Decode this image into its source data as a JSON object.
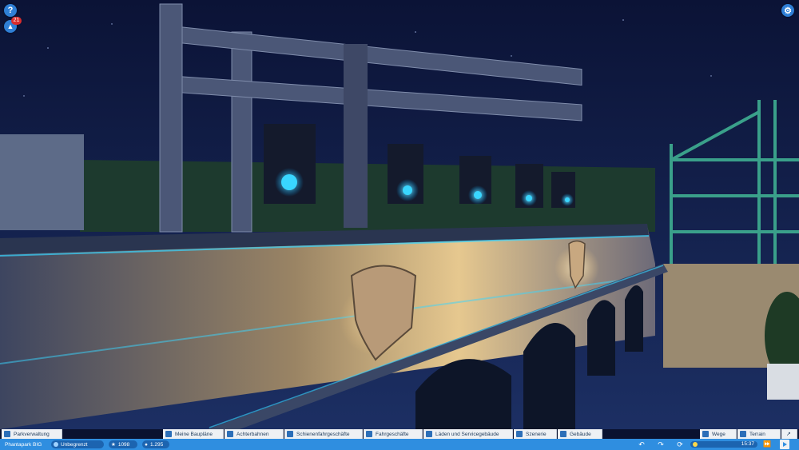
{
  "overlay": {
    "help_icon": "?",
    "notification_count": "21"
  },
  "tabs": [
    {
      "label": "Parkverwaltung",
      "icon": "castle-icon"
    },
    {
      "label": "Meine Baupläne",
      "icon": "blueprint-icon"
    },
    {
      "label": "Achterbahnen",
      "icon": "rollercoaster-icon"
    },
    {
      "label": "Schienenfahrgeschäfte",
      "icon": "train-icon"
    },
    {
      "label": "Fahrgeschäfte",
      "icon": "ride-icon"
    },
    {
      "label": "Läden und Servicegebäude",
      "icon": "shop-icon"
    },
    {
      "label": "Szenerie",
      "icon": "tree-icon"
    },
    {
      "label": "Gebäude",
      "icon": "building-icon"
    },
    {
      "label": "Wege",
      "icon": "path-icon"
    },
    {
      "label": "Terrain",
      "icon": "terrain-icon"
    }
  ],
  "status": {
    "park_name": "Phantapark BIG",
    "money": "Unbegrenzt",
    "rating": "1098",
    "guests": "1.295",
    "time": "15:37"
  },
  "colors": {
    "toolbar_blue": "#2f8ee0",
    "tab_bg": "#eef1f4",
    "accent_cyan": "#39d6ff"
  }
}
